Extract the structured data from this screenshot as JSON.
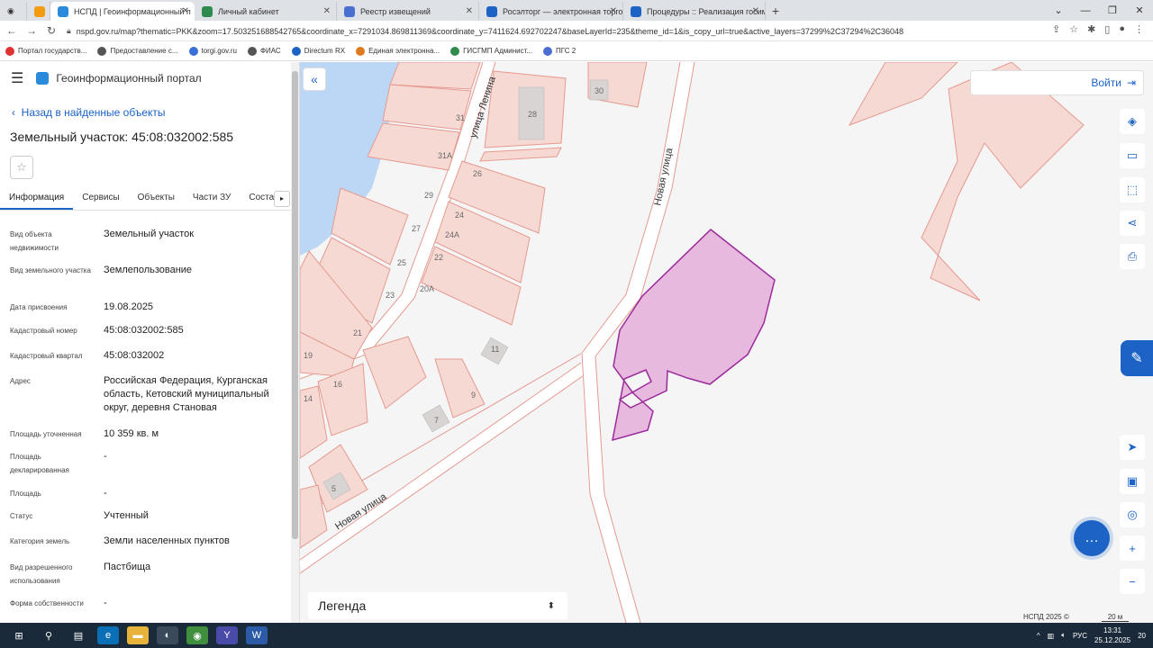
{
  "browser": {
    "tabs": [
      {
        "title": "НСПД | Геоинформационный п",
        "color": "#2a8bdc",
        "active": true
      },
      {
        "title": "Личный кабинет",
        "color": "#2f8a4e",
        "active": false
      },
      {
        "title": "Реестр извещений",
        "color": "#4b6fd1",
        "active": false
      },
      {
        "title": "Росэлторг — электронная торго",
        "color": "#1d63c6",
        "active": false
      },
      {
        "title": "Процедуры :: Реализация госим",
        "color": "#1d63c6",
        "active": false
      }
    ],
    "url": "nspd.gov.ru/map?thematic=PKK&zoom=17.503251688542765&coordinate_x=7291034.869811369&coordinate_y=7411624.692702247&baseLayerId=235&theme_id=1&is_copy_url=true&active_layers=37299%2C37294%2C36048",
    "bookmarks": [
      {
        "label": "Портал государств...",
        "color": "#d33"
      },
      {
        "label": "Предоставление с...",
        "color": "#555"
      },
      {
        "label": "torgi.gov.ru",
        "color": "#3a6fd8"
      },
      {
        "label": "ФИАС",
        "color": "#555"
      },
      {
        "label": "Directum RX",
        "color": "#1d63c6"
      },
      {
        "label": "Единая электронна...",
        "color": "#e07a1f"
      },
      {
        "label": "ГИСГМП Админист...",
        "color": "#2f8a4e"
      },
      {
        "label": "ПГС 2",
        "color": "#4b6fd1"
      }
    ]
  },
  "panel": {
    "portal_title": "Геоинформационный портал",
    "back_label": "Назад в найденные объекты",
    "object_title": "Земельный участок: 45:08:032002:585",
    "tabs": [
      "Информация",
      "Сервисы",
      "Объекты",
      "Части ЗУ",
      "Соста"
    ],
    "properties": [
      {
        "label": "Вид объекта недвижимости",
        "value": "Земельный участок"
      },
      {
        "label": "Вид земельного участка",
        "value": "Землепользование"
      },
      {
        "label": "Дата присвоения",
        "value": "19.08.2025"
      },
      {
        "label": "Кадастровый номер",
        "value": "45:08:032002:585"
      },
      {
        "label": "Кадастровый квартал",
        "value": "45:08:032002"
      },
      {
        "label": "Адрес",
        "value": "Российская Федерация, Курганская область, Кетовский муниципальный округ, деревня Становая"
      },
      {
        "label": "Площадь уточненная",
        "value": "10 359 кв. м"
      },
      {
        "label": "Площадь декларированная",
        "value": "-"
      },
      {
        "label": "Площадь",
        "value": "-"
      },
      {
        "label": "Статус",
        "value": "Учтенный"
      },
      {
        "label": "Категория земель",
        "value": "Земли населенных пунктов"
      },
      {
        "label": "Вид разрешенного использования",
        "value": "Пастбища"
      },
      {
        "label": "Форма собственности",
        "value": "-"
      }
    ]
  },
  "map": {
    "login_label": "Войти",
    "legend_label": "Легенда",
    "street_lenina": "улица Ленина",
    "street_novaya_1": "Новая улица",
    "street_novaya_2": "Новая улица",
    "copyright": "НСПД 2025 ©",
    "scale": "20 м",
    "parcel_numbers": [
      "30",
      "28",
      "31",
      "31А",
      "26",
      "29",
      "24",
      "24А",
      "27",
      "22",
      "25",
      "20А",
      "23",
      "11",
      "21",
      "19",
      "16",
      "9",
      "14",
      "7",
      "5"
    ],
    "selected_parcel_color": "#e7b9de",
    "parcel_fill": "#f6d9d3",
    "parcel_stroke": "#e59a90",
    "water_color": "#bcd7f5"
  },
  "taskbar": {
    "lang": "РУС",
    "time": "13:31",
    "date": "25.12.2025",
    "notifications": "20"
  }
}
